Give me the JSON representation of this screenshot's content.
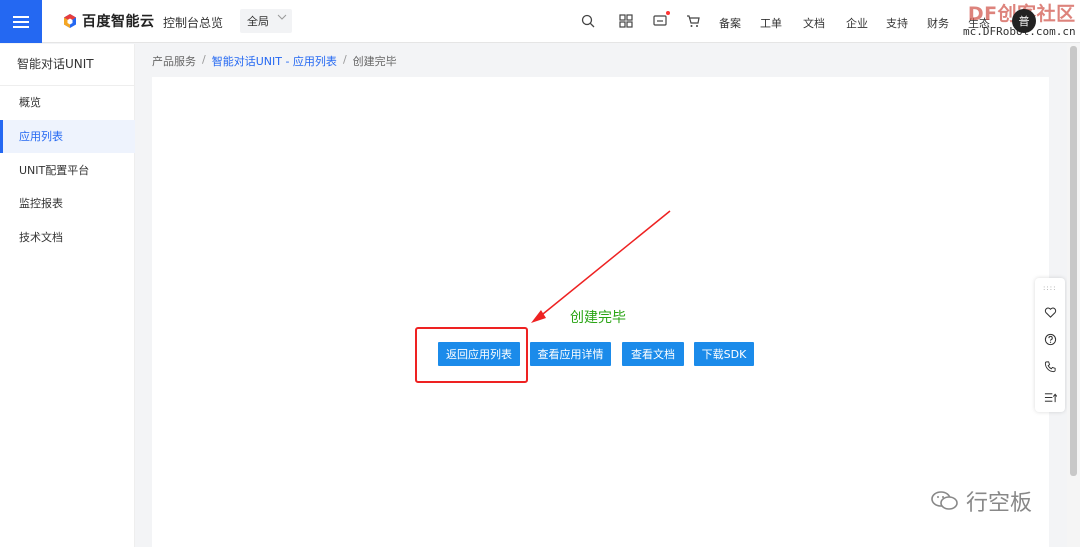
{
  "header": {
    "menu_icon": "hamburger-icon",
    "brand_name": "百度智能云",
    "console_link": "控制台总览",
    "region": "全局",
    "nav_items": [
      "备案",
      "工单",
      "文档",
      "企业",
      "支持",
      "财务",
      "生态"
    ],
    "avatar_text": "普",
    "watermark_title": "DF创客社区",
    "watermark_url": "mc.DFRobot.com.cn"
  },
  "sidebar": {
    "title": "智能对话UNIT",
    "items": [
      {
        "label": "概览",
        "active": false
      },
      {
        "label": "应用列表",
        "active": true
      },
      {
        "label": "UNIT配置平台",
        "active": false
      },
      {
        "label": "监控报表",
        "active": false
      },
      {
        "label": "技术文档",
        "active": false
      }
    ]
  },
  "breadcrumb": {
    "item1": "产品服务",
    "sep": "/",
    "item2": "智能对话UNIT - 应用列表",
    "item3": "创建完毕"
  },
  "main": {
    "status_title": "创建完毕",
    "buttons": {
      "back": "返回应用列表",
      "details": "查看应用详情",
      "docs": "查看文档",
      "sdk": "下载SDK"
    }
  },
  "floating_toolbar": {
    "handle": "::::",
    "icons": [
      "heart-icon",
      "help-icon",
      "phone-icon",
      "list-icon"
    ]
  },
  "bottom_watermark": {
    "text": "行空板"
  },
  "colors": {
    "accent": "#2468f2",
    "button": "#1b8bea",
    "success": "#2aa515",
    "annotation": "#e22222"
  }
}
